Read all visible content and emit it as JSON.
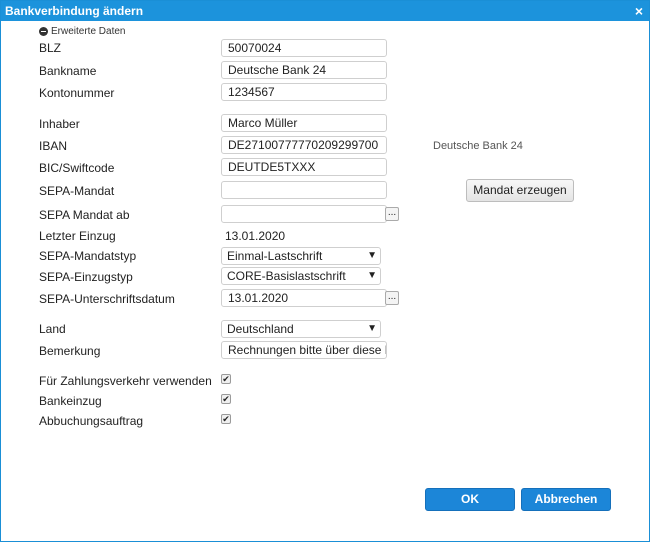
{
  "dialog": {
    "title": "Bankverbindung ändern",
    "close_glyph": "×"
  },
  "advanced_toggle": "Erweiterte Daten",
  "labels": {
    "blz": "BLZ",
    "bankname": "Bankname",
    "kontonummer": "Kontonummer",
    "inhaber": "Inhaber",
    "iban": "IBAN",
    "bic": "BIC/Swiftcode",
    "sepa_mandat": "SEPA-Mandat",
    "sepa_mandat_ab": "SEPA Mandat ab",
    "letzter_einzug": "Letzter Einzug",
    "mandatstyp": "SEPA-Mandatstyp",
    "einzugstyp": "SEPA-Einzugstyp",
    "unterschriftsdatum": "SEPA-Unterschriftsdatum",
    "land": "Land",
    "bemerkung": "Bemerkung",
    "zahlungsverkehr": "Für Zahlungsverkehr verwenden",
    "bankeinzug": "Bankeinzug",
    "abbuchungsauftrag": "Abbuchungsauftrag"
  },
  "values": {
    "blz": "50070024",
    "bankname": "Deutsche Bank 24",
    "kontonummer": "1234567",
    "inhaber": "Marco Müller",
    "iban": "DE27100777770209299700",
    "bic": "DEUTDE5TXXX",
    "sepa_mandat": "",
    "sepa_mandat_ab": "",
    "letzter_einzug": "13.01.2020",
    "mandatstyp": "Einmal-Lastschrift",
    "einzugstyp": "CORE-Basislastschrift",
    "unterschriftsdatum": "13.01.2020",
    "land": "Deutschland",
    "bemerkung": "Rechnungen bitte über diese Ba"
  },
  "iban_bank_hint": "Deutsche Bank 24",
  "checkboxes": {
    "zahlungsverkehr": true,
    "bankeinzug": true,
    "abbuchungsauftrag": true
  },
  "buttons": {
    "mandat_erzeugen": "Mandat erzeugen",
    "ok": "OK",
    "abbrechen": "Abbrechen",
    "date_picker": "..."
  },
  "icons": {
    "collapse": "minus-circle-icon",
    "dropdown": "▼",
    "check": "✔"
  }
}
